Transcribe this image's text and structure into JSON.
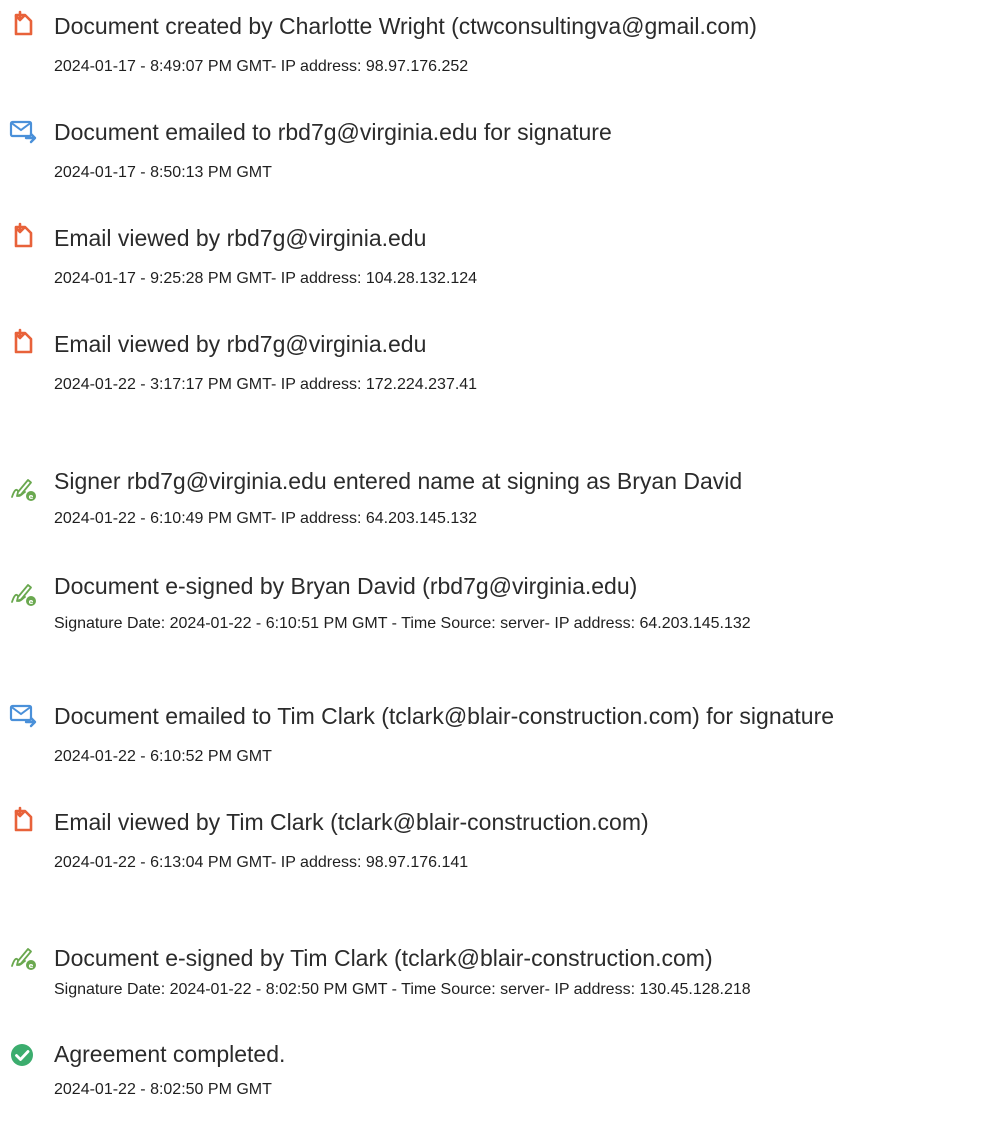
{
  "colors": {
    "doc_icon": "#e8623a",
    "email_icon": "#4a90d9",
    "sign_icon": "#6aa84f",
    "complete_icon": "#3cad6e",
    "text": "#222222"
  },
  "events": [
    {
      "icon": "document-icon",
      "title": "Document created by Charlotte Wright (ctwconsultingva@gmail.com)",
      "detail": "2024-01-17 - 8:49:07 PM GMT- IP address: 98.97.176.252"
    },
    {
      "icon": "email-icon",
      "title": "Document emailed to rbd7g@virginia.edu for signature",
      "detail": "2024-01-17 - 8:50:13 PM GMT"
    },
    {
      "icon": "document-icon",
      "title": "Email viewed by rbd7g@virginia.edu",
      "detail": "2024-01-17 - 9:25:28 PM GMT- IP address: 104.28.132.124"
    },
    {
      "icon": "document-icon",
      "title": "Email viewed by rbd7g@virginia.edu",
      "detail": "2024-01-22 - 3:17:17 PM GMT- IP address: 172.224.237.41"
    },
    {
      "icon": "signature-icon",
      "title": "Signer rbd7g@virginia.edu entered name at signing as Bryan David",
      "detail": "2024-01-22 - 6:10:49 PM GMT- IP address: 64.203.145.132"
    },
    {
      "icon": "signature-icon",
      "title": "Document e-signed by Bryan David (rbd7g@virginia.edu)",
      "detail": "Signature Date: 2024-01-22 - 6:10:51 PM GMT - Time Source: server- IP address: 64.203.145.132"
    },
    {
      "icon": "email-icon",
      "title": "Document emailed to Tim Clark (tclark@blair-construction.com) for signature",
      "detail": "2024-01-22 - 6:10:52 PM GMT"
    },
    {
      "icon": "document-icon",
      "title": "Email viewed by Tim Clark (tclark@blair-construction.com)",
      "detail": "2024-01-22 - 6:13:04 PM GMT- IP address: 98.97.176.141"
    },
    {
      "icon": "signature-icon",
      "title": "Document e-signed by Tim Clark (tclark@blair-construction.com)",
      "detail": "Signature Date: 2024-01-22 - 8:02:50 PM GMT - Time Source: server- IP address: 130.45.128.218"
    },
    {
      "icon": "check-circle-icon",
      "title": "Agreement completed.",
      "detail": "2024-01-22 - 8:02:50 PM GMT"
    }
  ]
}
